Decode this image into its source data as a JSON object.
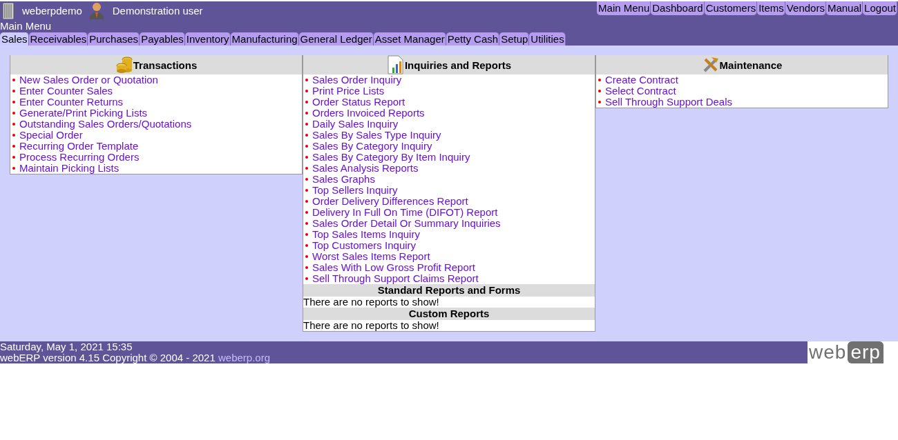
{
  "header": {
    "company": "weberpdemo",
    "user": "Demonstration user",
    "page_title": "Main Menu",
    "quick_links": [
      "Main Menu",
      "Dashboard",
      "Customers",
      "Items",
      "Vendors",
      "Manual",
      "Logout"
    ]
  },
  "tabs": [
    {
      "label": "Sales",
      "selected": true
    },
    {
      "label": "Receivables",
      "selected": false
    },
    {
      "label": "Purchases",
      "selected": false
    },
    {
      "label": "Payables",
      "selected": false
    },
    {
      "label": "Inventory",
      "selected": false
    },
    {
      "label": "Manufacturing",
      "selected": false
    },
    {
      "label": "General Ledger",
      "selected": false
    },
    {
      "label": "Asset Manager",
      "selected": false
    },
    {
      "label": "Petty Cash",
      "selected": false
    },
    {
      "label": "Setup",
      "selected": false
    },
    {
      "label": "Utilities",
      "selected": false
    }
  ],
  "sections": [
    {
      "kind": "coins",
      "title": "Transactions",
      "links": [
        "New Sales Order or Quotation",
        "Enter Counter Sales",
        "Enter Counter Returns",
        "Generate/Print Picking Lists",
        "Outstanding Sales Orders/Quotations",
        "Special Order",
        "Recurring Order Template",
        "Process Recurring Orders",
        "Maintain Picking Lists"
      ]
    },
    {
      "kind": "chart",
      "title": "Inquiries and Reports",
      "links": [
        "Sales Order Inquiry",
        "Print Price Lists",
        "Order Status Report",
        "Orders Invoiced Reports",
        "Daily Sales Inquiry",
        "Sales By Sales Type Inquiry",
        "Sales By Category Inquiry",
        "Sales By Category By Item Inquiry",
        "Sales Analysis Reports",
        "Sales Graphs",
        "Top Sellers Inquiry",
        "Order Delivery Differences Report",
        "Delivery In Full On Time (DIFOT) Report",
        "Sales Order Detail Or Summary Inquiries",
        "Top Sales Items Inquiry",
        "Top Customers Inquiry",
        "Worst Sales Items Report",
        "Sales With Low Gross Profit Report",
        "Sell Through Support Claims Report"
      ],
      "subsections": [
        {
          "title": "Standard Reports and Forms",
          "note": "There are no reports to show!"
        },
        {
          "title": "Custom Reports",
          "note": "There are no reports to show!"
        }
      ]
    },
    {
      "kind": "tools",
      "title": "Maintenance",
      "links": [
        "Create Contract",
        "Select Contract",
        "Sell Through Support Deals"
      ]
    }
  ],
  "footer": {
    "datetime": "Saturday, May 1, 2021 15:35",
    "copyright": "webERP version 4.15 Copyright © 2004 - 2021",
    "link": "weberp.org",
    "logo_left": "web",
    "logo_right": "erp"
  }
}
